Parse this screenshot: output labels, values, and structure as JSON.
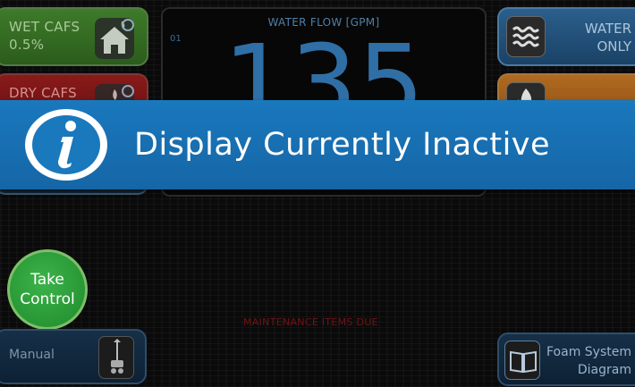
{
  "left_modes": {
    "wet_cafs": {
      "label": "WET CAFS",
      "value": "0.5%",
      "icon": "house-fire-icon",
      "color": "#3e7b2a"
    },
    "dry_cafs": {
      "label": "DRY CAFS",
      "value": "",
      "icon": "car-fire-icon",
      "color": "#8a1a1a"
    },
    "third": {
      "label": "",
      "icon": "fire-icon"
    }
  },
  "right_modes": {
    "water_only": {
      "label_line1": "WATER",
      "label_line2": "ONLY",
      "icon": "water-waves-icon",
      "color": "#2b5f8c"
    },
    "foam": {
      "label": "",
      "icon": "flame-icon",
      "color": "#b06a20"
    }
  },
  "flow": {
    "title": "WATER FLOW [GPM]",
    "marker": "01",
    "value": "135"
  },
  "banner": {
    "text": "Display Currently Inactive",
    "icon": "info-icon",
    "color": "#1a78bd"
  },
  "maintenance_text": "MAINTENANCE ITEMS DUE",
  "take_control": {
    "line1": "Take",
    "line2": "Control",
    "color": "#2c9e3a"
  },
  "manual": {
    "label": "Manual",
    "icon": "valve-handle-icon"
  },
  "foam_system_diagram": {
    "line1": "Foam System",
    "line2": "Diagram",
    "icon": "book-icon"
  }
}
